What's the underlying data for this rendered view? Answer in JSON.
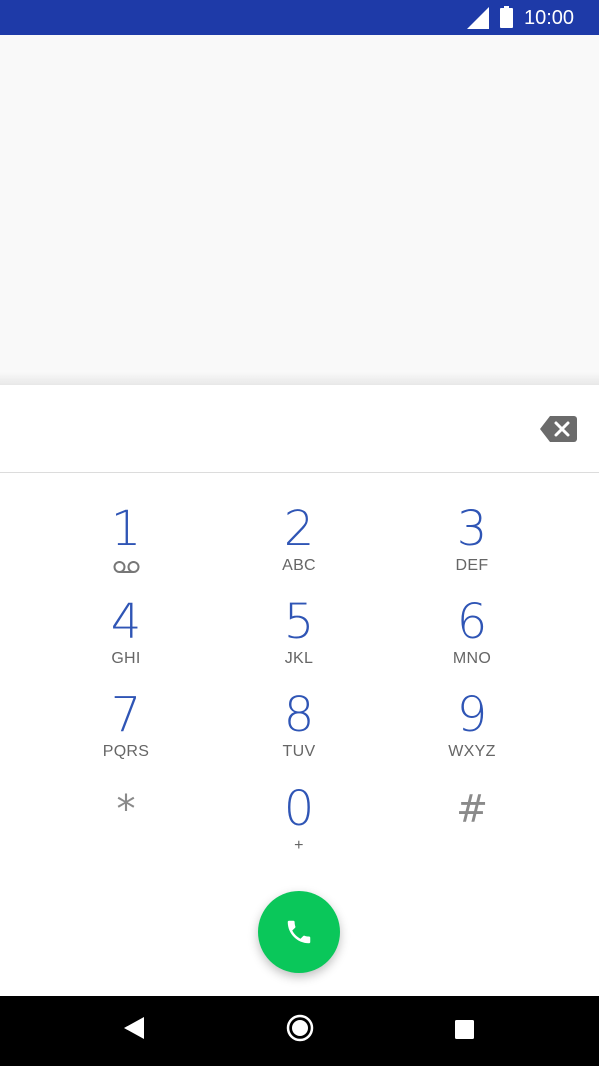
{
  "status_bar": {
    "time": "10:00",
    "icons": [
      "cellular-signal-icon",
      "battery-icon"
    ]
  },
  "dialer": {
    "digits_value": "",
    "backspace_icon": "backspace-icon",
    "keys": [
      {
        "digit": "1",
        "letters": "",
        "icon": "voicemail-icon"
      },
      {
        "digit": "2",
        "letters": "ABC"
      },
      {
        "digit": "3",
        "letters": "DEF"
      },
      {
        "digit": "4",
        "letters": "GHI"
      },
      {
        "digit": "5",
        "letters": "JKL"
      },
      {
        "digit": "6",
        "letters": "MNO"
      },
      {
        "digit": "7",
        "letters": "PQRS"
      },
      {
        "digit": "8",
        "letters": "TUV"
      },
      {
        "digit": "9",
        "letters": "WXYZ"
      },
      {
        "digit": "*",
        "letters": ""
      },
      {
        "digit": "0",
        "letters": "+"
      },
      {
        "digit": "#",
        "letters": ""
      }
    ],
    "call_icon": "phone-icon",
    "colors": {
      "status_bar": "#1e3aa8",
      "digit_blue": "#2f55b5",
      "call_green": "#0ac75a"
    }
  },
  "nav_bar": {
    "icons": [
      "back-icon",
      "home-icon",
      "recents-icon"
    ]
  }
}
